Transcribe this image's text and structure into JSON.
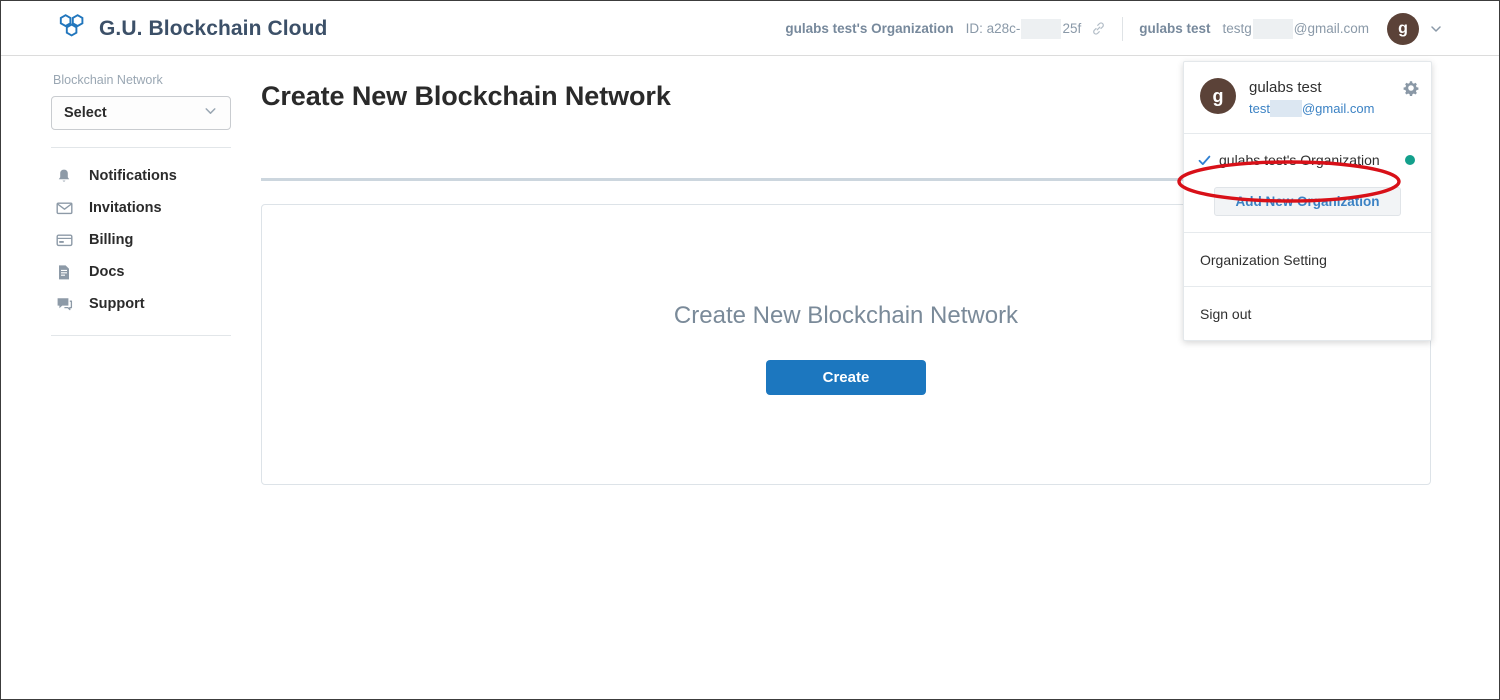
{
  "header": {
    "brand_title": "G.U. Blockchain Cloud",
    "logo_icon": "hexagon-cluster-logo",
    "org_name": "gulabs test's Organization",
    "org_id_prefix": "ID: a28c-",
    "org_id_suffix": "25f",
    "link_icon": "link-icon",
    "user_name": "gulabs test",
    "user_email_prefix": "testg",
    "user_email_suffix": "@gmail.com",
    "avatar_initial": "g",
    "caret_icon": "chevron-down-icon"
  },
  "sidebar": {
    "section_label": "Blockchain Network",
    "select": {
      "value": "Select",
      "icon": "chevron-down-icon"
    },
    "items": [
      {
        "label": "Notifications",
        "icon": "bell-icon"
      },
      {
        "label": "Invitations",
        "icon": "envelope-icon"
      },
      {
        "label": "Billing",
        "icon": "credit-card-icon"
      },
      {
        "label": "Docs",
        "icon": "document-icon"
      },
      {
        "label": "Support",
        "icon": "chat-bubble-icon"
      }
    ]
  },
  "main": {
    "page_title": "Create New Blockchain Network",
    "card": {
      "heading": "Create New Blockchain Network",
      "create_button": "Create"
    }
  },
  "dropdown": {
    "avatar_initial": "g",
    "full_name": "gulabs test",
    "email_prefix": "test",
    "email_suffix": "@gmail.com",
    "gear_icon": "gear-icon",
    "organizations": [
      {
        "name": "gulabs test's Organization",
        "selected": true,
        "check_icon": "check-icon",
        "status_dot_color": "#13a08c"
      }
    ],
    "add_org_button": "Add New Organization",
    "menu_items": [
      "Organization Setting",
      "Sign out"
    ]
  },
  "annotation": {
    "shape": "ellipse-highlight",
    "color": "#d81018",
    "target": "gulabs test's Organization"
  },
  "colors": {
    "accent_blue": "#1c77bf",
    "link_blue": "#3b82c4",
    "brand_navy": "#3c5068",
    "avatar_brown": "#5b4238",
    "status_green": "#13a08c",
    "annotation_red": "#d81018"
  }
}
